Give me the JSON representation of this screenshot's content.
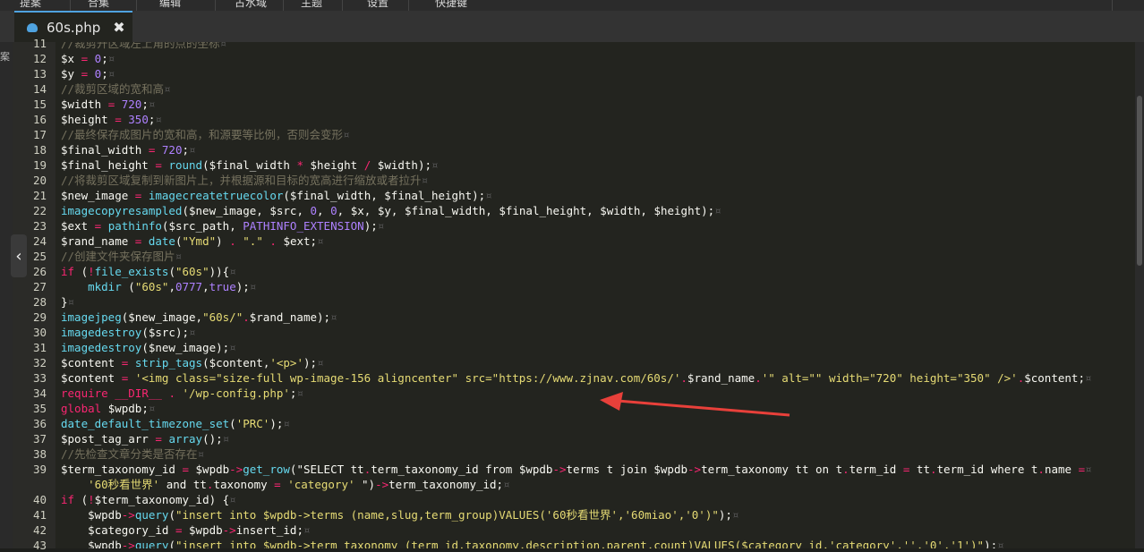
{
  "menubar": {
    "items": [
      "提案",
      "合集",
      "编辑",
      "古水域",
      "主题",
      "设置",
      "快捷键"
    ]
  },
  "tab": {
    "label": "60s.php",
    "close": "✖"
  },
  "side": {
    "label": "案"
  },
  "editor": {
    "lines": [
      {
        "n": "11",
        "t": "//裁剪开区域左上角的点的坐标"
      },
      {
        "n": "12",
        "t": "$x = 0;"
      },
      {
        "n": "13",
        "t": "$y = 0;"
      },
      {
        "n": "14",
        "t": "//裁剪区域的宽和高"
      },
      {
        "n": "15",
        "t": "$width = 720;"
      },
      {
        "n": "16",
        "t": "$height = 350;"
      },
      {
        "n": "17",
        "t": "//最终保存成图片的宽和高，和源要等比例，否则会变形"
      },
      {
        "n": "18",
        "t": "$final_width = 720;"
      },
      {
        "n": "19",
        "t": "$final_height = round($final_width * $height / $width);"
      },
      {
        "n": "20",
        "t": "//将裁剪区域复制到新图片上，并根据源和目标的宽高进行缩放或者拉升"
      },
      {
        "n": "21",
        "t": "$new_image = imagecreatetruecolor($final_width, $final_height);"
      },
      {
        "n": "22",
        "t": "imagecopyresampled($new_image, $src, 0, 0, $x, $y, $final_width, $final_height, $width, $height);"
      },
      {
        "n": "23",
        "t": "$ext = pathinfo($src_path, PATHINFO_EXTENSION);"
      },
      {
        "n": "24",
        "t": "$rand_name = date(\"Ymd\") . \".\" . $ext;"
      },
      {
        "n": "25",
        "t": "//创建文件夹保存图片"
      },
      {
        "n": "26",
        "t": "if (!file_exists(\"60s\")){"
      },
      {
        "n": "27",
        "t": "    mkdir (\"60s\",0777,true);"
      },
      {
        "n": "28",
        "t": "}"
      },
      {
        "n": "29",
        "t": "imagejpeg($new_image,\"60s/\".$rand_name);"
      },
      {
        "n": "30",
        "t": "imagedestroy($src);"
      },
      {
        "n": "31",
        "t": "imagedestroy($new_image);"
      },
      {
        "n": "32",
        "t": "$content = strip_tags($content,'<p>');"
      },
      {
        "n": "33",
        "t": "$content = '<img class=\"size-full wp-image-156 aligncenter\" src=\"https://www.zjnav.com/60s/'.$rand_name.'\" alt=\"\" width=\"720\" height=\"350\" />'.$content;"
      },
      {
        "n": "34",
        "t": "require __DIR__ . '/wp-config.php';"
      },
      {
        "n": "35",
        "t": "global $wpdb;"
      },
      {
        "n": "36",
        "t": "date_default_timezone_set('PRC');"
      },
      {
        "n": "37",
        "t": "$post_tag_arr = array();"
      },
      {
        "n": "38",
        "t": "//先检查文章分类是否存在"
      },
      {
        "n": "39",
        "t": "$term_taxonomy_id = $wpdb->get_row(\"SELECT tt.term_taxonomy_id from $wpdb->terms t join $wpdb->term_taxonomy tt on t.term_id = tt.term_id where t.name ="
      },
      {
        "n": "",
        "t": "    '60秒看世界' and tt.taxonomy = 'category' \")->term_taxonomy_id;"
      },
      {
        "n": "40",
        "t": "if (!$term_taxonomy_id) {"
      },
      {
        "n": "41",
        "t": "    $wpdb->query(\"insert into $wpdb->terms (name,slug,term_group)VALUES('60秒看世界','60miao','0')\");"
      },
      {
        "n": "42",
        "t": "    $category_id = $wpdb->insert_id;"
      },
      {
        "n": "43",
        "t": "    $wpdb->query(\"insert into $wpdb->term_taxonomy (term_id,taxonomy,description,parent,count)VALUES($category_id,'category','','0','1')\");"
      }
    ]
  },
  "colors": {
    "accent": "#4fa3e0",
    "arrow": "#e8403a",
    "background": "#23241f"
  }
}
